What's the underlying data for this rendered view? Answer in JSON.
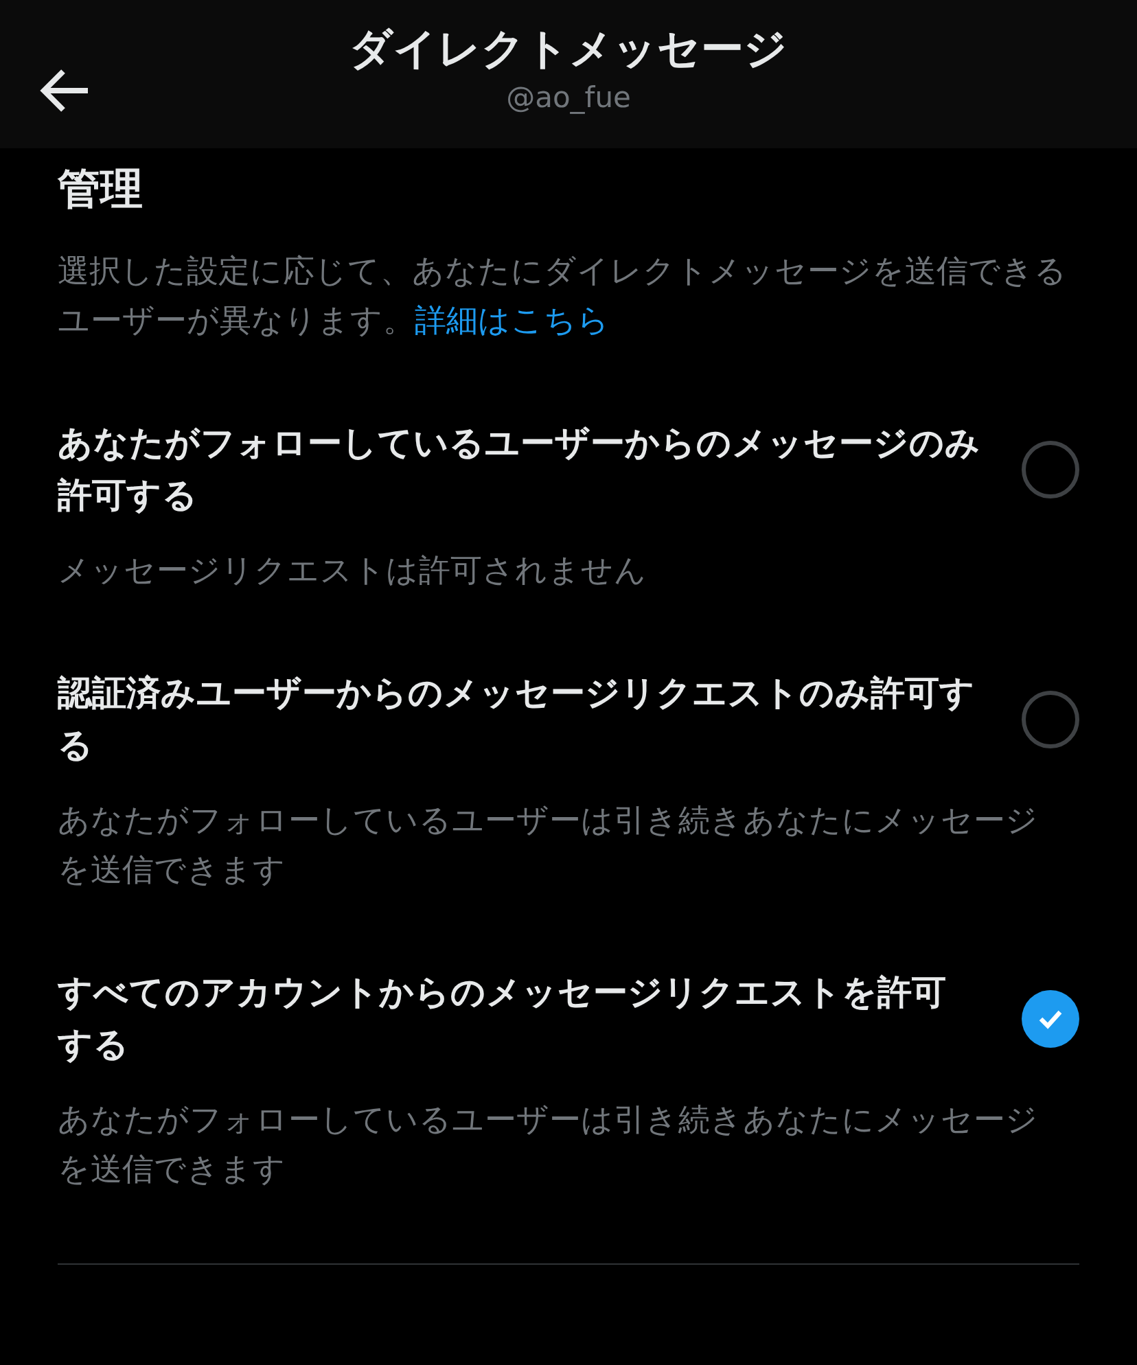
{
  "header": {
    "title": "ダイレクトメッセージ",
    "subtitle": "@ao_fue"
  },
  "section": {
    "title": "管理",
    "description": "選択した設定に応じて、あなたにダイレクトメッセージを送信できるユーザーが異なります。",
    "link": "詳細はこちら"
  },
  "options": [
    {
      "label": "あなたがフォローしているユーザーからのメッセージのみ許可する",
      "note": "メッセージリクエストは許可されません",
      "selected": false
    },
    {
      "label": "認証済みユーザーからのメッセージリクエストのみ許可する",
      "note": "あなたがフォローしているユーザーは引き続きあなたにメッセージを送信できます",
      "selected": false
    },
    {
      "label": "すべてのアカウントからのメッセージリクエストを許可する",
      "note": "あなたがフォローしているユーザーは引き続きあなたにメッセージを送信できます",
      "selected": true
    }
  ]
}
